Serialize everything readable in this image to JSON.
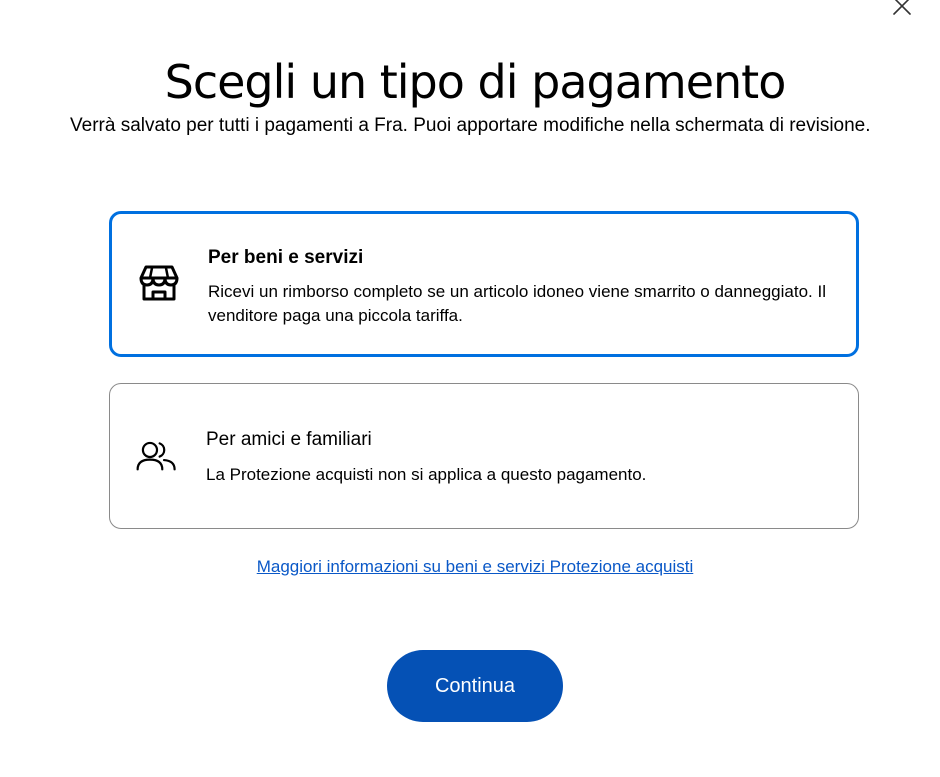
{
  "dialog": {
    "close_icon": "close-icon",
    "title": "Scegli un tipo di pagamento",
    "subtitle": "Verrà salvato per tutti i pagamenti a Fra. Puoi apportare modifiche nella schermata di revisione."
  },
  "options": [
    {
      "id": "goods-services",
      "icon": "storefront-icon",
      "title": "Per beni e servizi",
      "description": "Ricevi un rimborso completo se un articolo idoneo viene smarrito o danneggiato. Il venditore paga una piccola tariffa.",
      "selected": true
    },
    {
      "id": "friends-family",
      "icon": "people-icon",
      "title": "Per amici e familiari",
      "description": "La Protezione acquisti non si applica a questo pagamento.",
      "selected": false
    }
  ],
  "info_link": {
    "label": "Maggiori informazioni su beni e servizi Protezione acquisti"
  },
  "continue_button": {
    "label": "Continua"
  },
  "colors": {
    "accent": "#0070e0",
    "button": "#0551b5",
    "link": "#0a58c7"
  }
}
